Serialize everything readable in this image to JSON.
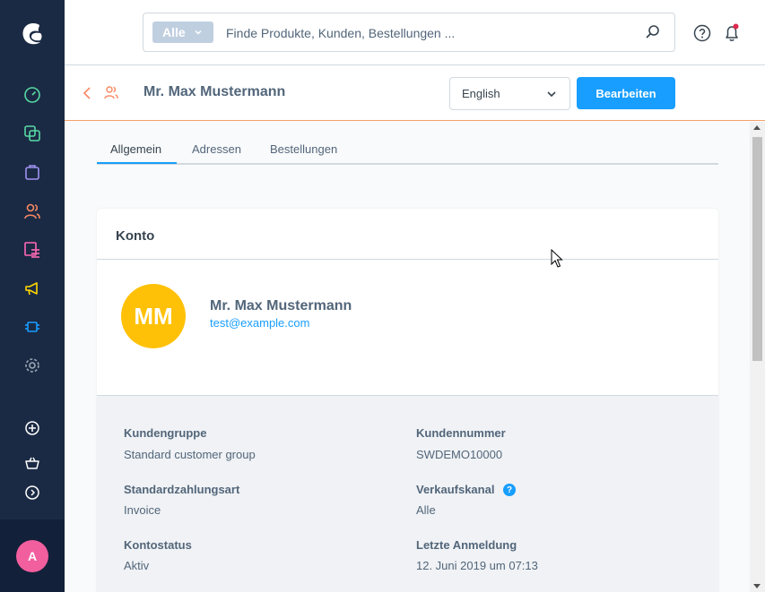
{
  "sidebar": {
    "icons": [
      {
        "name": "dashboard-icon",
        "color": "#57d9a3"
      },
      {
        "name": "catalogues-icon",
        "color": "#57d9a3"
      },
      {
        "name": "orders-icon",
        "color": "#a092f0"
      },
      {
        "name": "customers-icon",
        "color": "#f88962"
      },
      {
        "name": "content-icon",
        "color": "#ff68b4"
      },
      {
        "name": "marketing-icon",
        "color": "#ffd700"
      },
      {
        "name": "extensions-icon",
        "color": "#189eff"
      },
      {
        "name": "settings-icon",
        "color": "#9aa8b5"
      },
      {
        "name": "add-icon",
        "color": "#ffffff"
      },
      {
        "name": "shop-icon",
        "color": "#ffffff"
      },
      {
        "name": "collapse-icon",
        "color": "#ffffff"
      }
    ],
    "user_initial": "A",
    "user_color": "#f25f9e"
  },
  "search": {
    "type_label": "Alle",
    "placeholder": "Finde Produkte, Kunden, Bestellungen ..."
  },
  "smartbar": {
    "title": "Mr. Max Mustermann",
    "language": "English",
    "edit_label": "Bearbeiten"
  },
  "tabs": [
    "Allgemein",
    "Adressen",
    "Bestellungen"
  ],
  "card": {
    "title": "Konto",
    "initials": "MM",
    "name": "Mr. Max Mustermann",
    "email": "test@example.com",
    "fields": [
      {
        "label": "Kundengruppe",
        "value": "Standard customer group"
      },
      {
        "label": "Kundennummer",
        "value": "SWDEMO10000"
      },
      {
        "label": "Standardzahlungsart",
        "value": "Invoice"
      },
      {
        "label": "Verkaufskanal",
        "value": "Alle"
      },
      {
        "label": "Kontostatus",
        "value": "Aktiv"
      },
      {
        "label": "Letzte Anmeldung",
        "value": "12. Juni 2019 um 07:13"
      }
    ],
    "help_badge": "?"
  },
  "colors": {
    "accent": "#189eff",
    "sidebar_bg": "#1b2a44",
    "avatar_bg": "#ffc107",
    "module_accent": "#f88962"
  }
}
